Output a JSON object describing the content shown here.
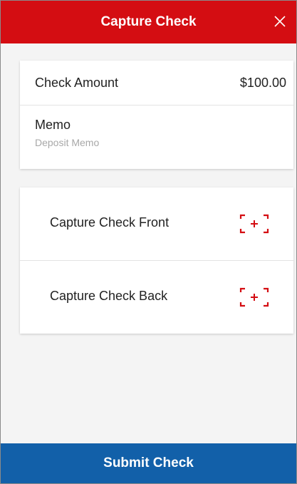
{
  "header": {
    "title": "Capture Check",
    "close_icon": "close-icon"
  },
  "amount_card": {
    "amount_label": "Check Amount",
    "amount_value": "$100.00",
    "memo_label": "Memo",
    "memo_value": "",
    "memo_placeholder": "Deposit Memo"
  },
  "capture_card": {
    "front_label": "Capture Check Front",
    "back_label": "Capture Check Back",
    "icon": "camera-frame-icon"
  },
  "footer": {
    "submit_label": "Submit Check"
  },
  "colors": {
    "header_bg": "#d40d12",
    "submit_bg": "#1260a9",
    "icon_color": "#d40d12",
    "page_bg": "#f4f4f4"
  }
}
